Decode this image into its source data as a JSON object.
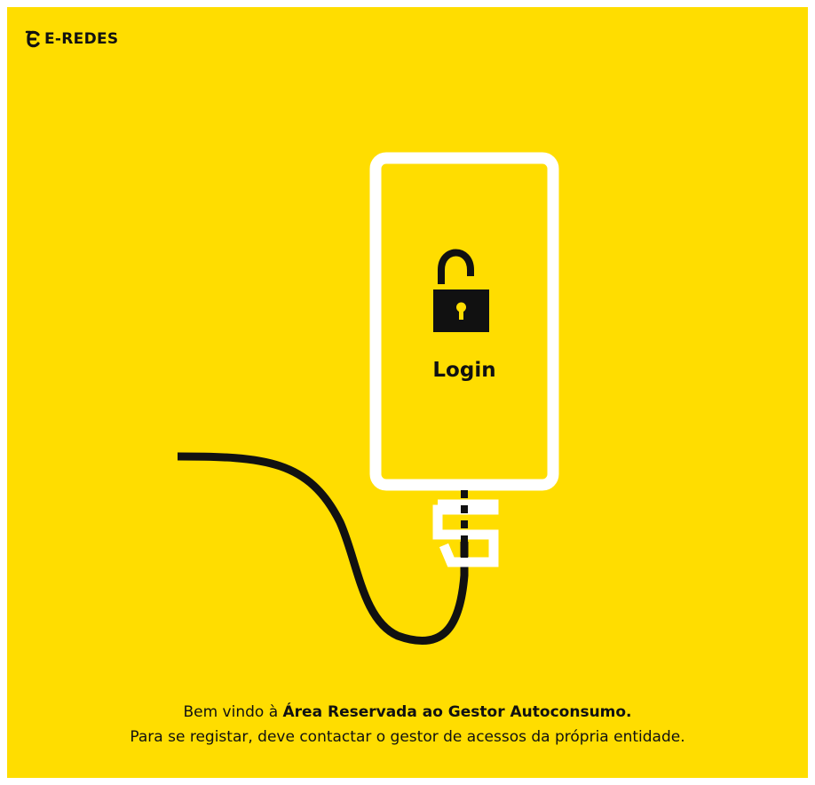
{
  "header": {
    "brand_name": "E-REDES",
    "brand_logo_icon": "e-redes-logo-icon"
  },
  "main": {
    "login_label": "Login",
    "lock_icon": "unlocked-padlock-icon",
    "illustration_icon": "phone-with-cable-icon"
  },
  "footer": {
    "welcome_prefix": "Bem vindo à ",
    "welcome_highlight": "Área Reservada ao Gestor Autoconsumo.",
    "register_notice": "Para se registar, deve contactar o gestor de acessos da própria entidade."
  },
  "colors": {
    "background": "#FFDD00",
    "ink": "#111111",
    "outline": "#FFFFFF"
  }
}
